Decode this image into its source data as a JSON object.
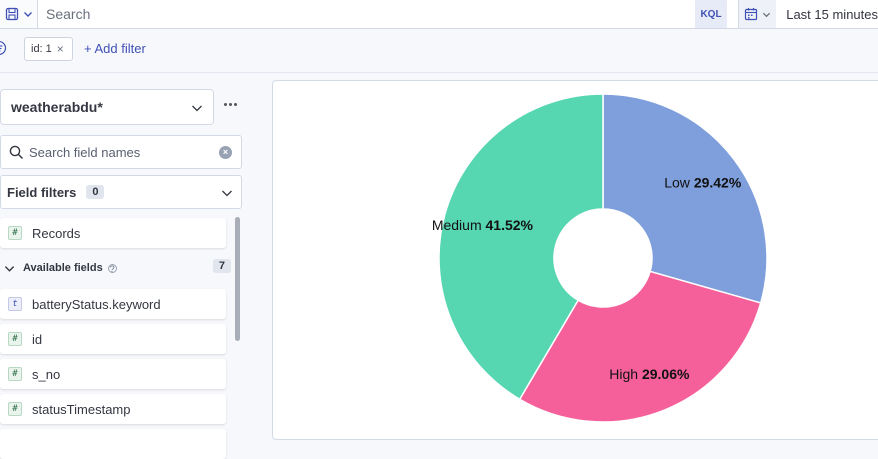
{
  "topbar": {
    "search_placeholder": "Search",
    "kql_label": "KQL",
    "date_range": "Last 15 minutes"
  },
  "filters": {
    "pill_label": "id: 1",
    "pill_close": "×",
    "add_filter": "+ Add filter"
  },
  "sidebar": {
    "data_view": "weatherabdu*",
    "field_search_placeholder": "Search field names",
    "field_filters_label": "Field filters",
    "field_filters_count": "0",
    "records_field": {
      "type": "#",
      "name": "Records"
    },
    "available_label": "Available fields",
    "available_count": "7",
    "fields": [
      {
        "type": "t",
        "name": "batteryStatus.keyword"
      },
      {
        "type": "#",
        "name": "id"
      },
      {
        "type": "#",
        "name": "s_no"
      },
      {
        "type": "#",
        "name": "statusTimestamp"
      }
    ]
  },
  "colors": {
    "accent": "#3f51b5",
    "low": "#7f9fdc",
    "high": "#f6609a",
    "medium": "#57d6b2"
  },
  "chart_data": {
    "type": "pie",
    "donut": true,
    "slices": [
      {
        "name": "Low",
        "value": 29.42,
        "pct_label": "29.42%",
        "color": "#7f9fdc"
      },
      {
        "name": "High",
        "value": 29.06,
        "pct_label": "29.06%",
        "color": "#f6609a"
      },
      {
        "name": "Medium",
        "value": 41.52,
        "pct_label": "41.52%",
        "color": "#57d6b2"
      }
    ]
  }
}
